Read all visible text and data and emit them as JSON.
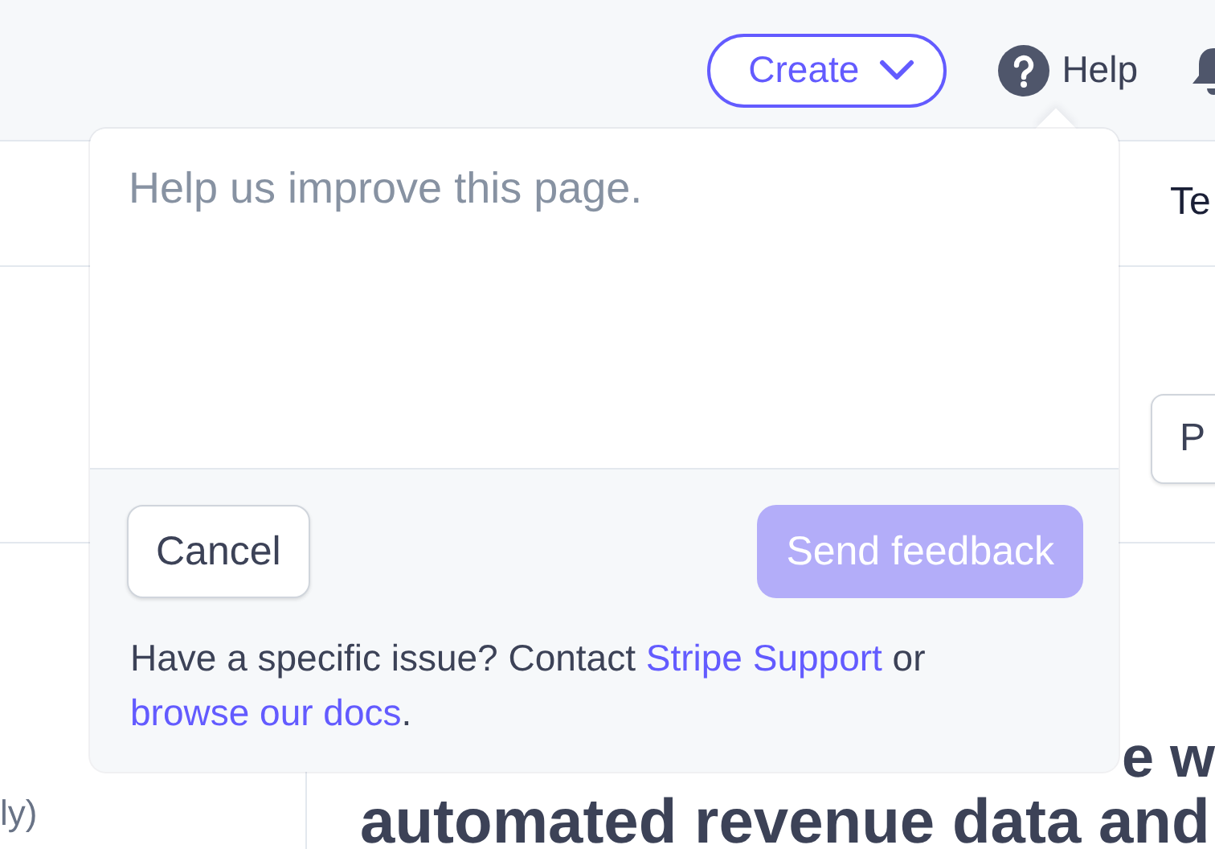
{
  "top_bar": {
    "create_button": "Create",
    "help_link": "Help"
  },
  "background": {
    "tab_fragment": "Te",
    "button_fragment": "P",
    "note_fragment": "ly)",
    "heading_lines": [
      "e w",
      "automated revenue data and"
    ]
  },
  "feedback_popover": {
    "placeholder": "Help us improve this page.",
    "cancel_button": "Cancel",
    "send_button": {
      "label": "Send feedback",
      "disabled": true
    },
    "note": [
      {
        "kind": "text",
        "text": "Have a specific issue? Contact "
      },
      {
        "kind": "link",
        "text": "Stripe Support"
      },
      {
        "kind": "text",
        "text": " or "
      },
      {
        "kind": "link",
        "text": "browse our docs"
      },
      {
        "kind": "text",
        "text": "."
      }
    ]
  }
}
